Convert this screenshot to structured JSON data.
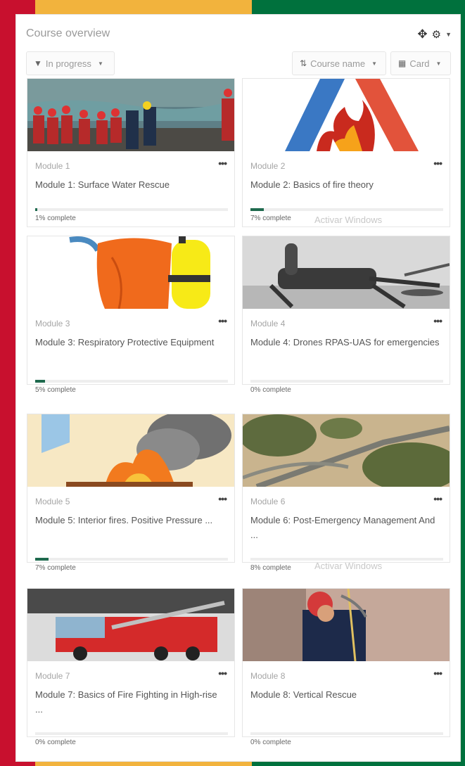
{
  "header": {
    "title": "Course overview"
  },
  "filters": {
    "status_label": "In progress",
    "sort_label": "Course name",
    "view_label": "Card"
  },
  "courses": [
    {
      "category": "Module 1",
      "name": "Module 1: Surface Water Rescue",
      "progress": 1,
      "progress_text": "1% complete",
      "image": "water-rescue-team"
    },
    {
      "category": "Module 2",
      "name": "Module 2: Basics of fire theory",
      "progress": 7,
      "progress_text": "7% complete",
      "image": "fire-triangle"
    },
    {
      "category": "Module 3",
      "name": "Module 3: Respiratory Protective Equipment",
      "progress": 5,
      "progress_text": "5% complete",
      "image": "breathing-apparatus"
    },
    {
      "category": "Module 4",
      "name": "Module 4: Drones RPAS-UAS for emergencies",
      "progress": 0,
      "progress_text": "0% complete",
      "image": "drone"
    },
    {
      "category": "Module 5",
      "name": "Module 5: Interior fires. Positive Pressure ...",
      "progress": 7,
      "progress_text": "7% complete",
      "image": "interior-fire"
    },
    {
      "category": "Module 6",
      "name": "Module 6: Post-Emergency Management And ...",
      "progress": 0,
      "progress_text": "8% complete",
      "image": "flooded-road"
    },
    {
      "category": "Module 7",
      "name": "Module 7: Basics of Fire Fighting in High-rise ...",
      "progress": 0,
      "progress_text": "0% complete",
      "image": "fire-truck"
    },
    {
      "category": "Module 8",
      "name": "Module 8: Vertical Rescue",
      "progress": 0,
      "progress_text": "0% complete",
      "image": "vertical-rescue"
    }
  ],
  "overlay": {
    "watermark": "Activar Windows"
  },
  "icons": [
    "move-icon",
    "gear-icon",
    "filter-icon",
    "sort-icon",
    "grid-icon",
    "more-icon"
  ],
  "colors": {
    "frame_red": "#c8102e",
    "frame_yellow": "#f2b33d",
    "frame_green": "#00713d",
    "progress": "#1f6a4e"
  }
}
